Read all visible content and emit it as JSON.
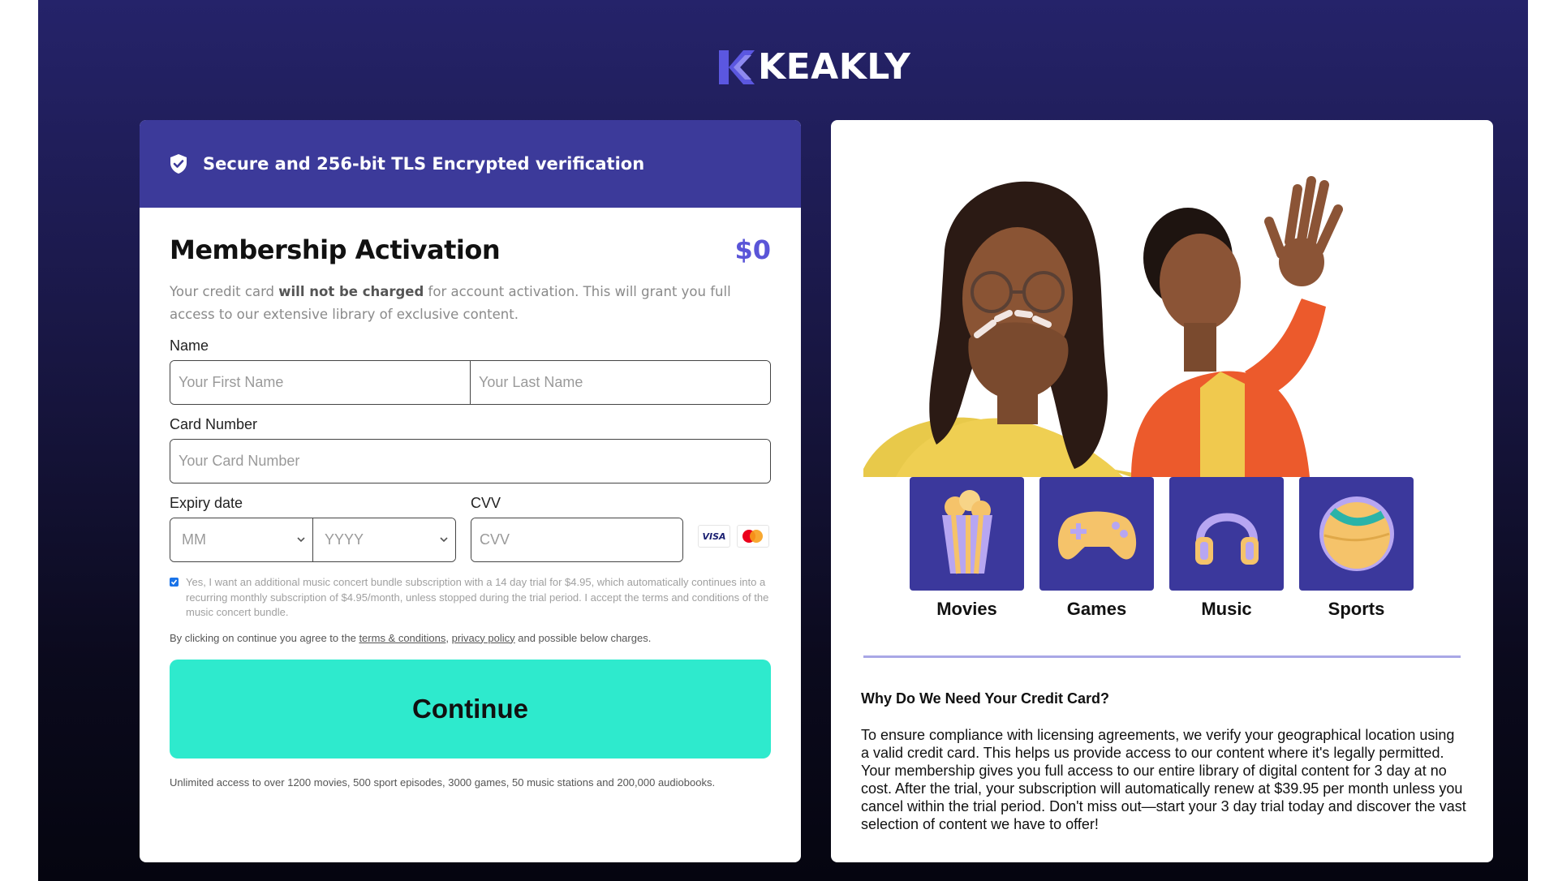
{
  "brand": {
    "name": "KEAKLY",
    "accent": "#3c3a9a",
    "cta_color": "#2eeacd",
    "price_color": "#5a55d8"
  },
  "banner": {
    "text": "Secure and 256-bit TLS Encrypted verification",
    "icon": "shield-check-icon"
  },
  "form": {
    "title": "Membership Activation",
    "price": "$0",
    "intro_prefix": "Your credit card ",
    "intro_bold": "will not be charged",
    "intro_suffix": " for account activation. This will grant you full access to our extensive library of exclusive content.",
    "name_label": "Name",
    "first_name_placeholder": "Your First Name",
    "last_name_placeholder": "Your Last Name",
    "card_label": "Card Number",
    "card_placeholder": "Your Card Number",
    "expiry_label": "Expiry date",
    "month_value": "MM",
    "year_value": "YYYY",
    "cvv_label": "CVV",
    "cvv_placeholder": "CVV",
    "card_brands": [
      "VISA",
      "Mastercard"
    ],
    "consent_checked": true,
    "consent_text": "Yes, I want an additional music concert bundle subscription with a 14 day trial for $4.95, which automatically continues into a recurring monthly subscription of $4.95/month, unless stopped during the trial period. I accept the terms and conditions of the music concert bundle.",
    "agree_prefix": "By clicking on continue you agree to the ",
    "terms_link": "terms & conditions",
    "agree_sep": ", ",
    "privacy_link": "privacy policy",
    "agree_suffix": " and possible below charges.",
    "continue_label": "Continue",
    "footnote": "Unlimited access to over 1200 movies, 500 sport episodes, 3000 games, 50 music stations and 200,000 audiobooks."
  },
  "categories": [
    {
      "label": "Movies",
      "icon": "popcorn-icon"
    },
    {
      "label": "Games",
      "icon": "gamepad-icon"
    },
    {
      "label": "Music",
      "icon": "headphones-icon"
    },
    {
      "label": "Sports",
      "icon": "ball-icon"
    }
  ],
  "info": {
    "title": "Why Do We Need Your Credit Card?",
    "body": "To ensure compliance with licensing agreements, we verify your geographical location using a valid credit card. This helps us provide access to our content where it's legally permitted. Your membership gives you full access to our entire library of digital content for 3 day at no cost. After the trial, your subscription will automatically renew at $39.95 per month unless you cancel within the trial period. Don't miss out—start your 3 day trial today and discover the vast selection of content we have to offer!"
  }
}
